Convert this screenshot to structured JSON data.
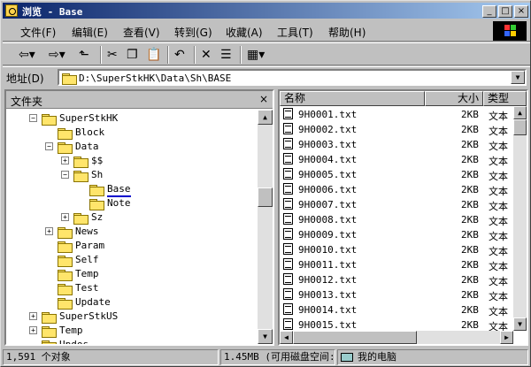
{
  "window": {
    "title": "浏览 - Base"
  },
  "menu": [
    "文件(F)",
    "编辑(E)",
    "查看(V)",
    "转到(G)",
    "收藏(A)",
    "工具(T)",
    "帮助(H)"
  ],
  "address": {
    "label": "地址(D)",
    "value": "D:\\SuperStkHK\\Data\\Sh\\BASE"
  },
  "tree": {
    "title": "文件夹",
    "close": "×",
    "items": [
      {
        "label": "SuperStkHK",
        "exp": "−"
      },
      {
        "label": "Block",
        "exp": ""
      },
      {
        "label": "Data",
        "exp": "−"
      },
      {
        "label": "$$",
        "exp": "+"
      },
      {
        "label": "Sh",
        "exp": "−"
      },
      {
        "label": "Base",
        "exp": ""
      },
      {
        "label": "Note",
        "exp": ""
      },
      {
        "label": "Sz",
        "exp": "+"
      },
      {
        "label": "News",
        "exp": "+"
      },
      {
        "label": "Param",
        "exp": ""
      },
      {
        "label": "Self",
        "exp": ""
      },
      {
        "label": "Temp",
        "exp": ""
      },
      {
        "label": "Test",
        "exp": ""
      },
      {
        "label": "Update",
        "exp": ""
      },
      {
        "label": "SuperStkUS",
        "exp": "+"
      },
      {
        "label": "Temp",
        "exp": "+"
      },
      {
        "label": "Updos",
        "exp": ""
      }
    ]
  },
  "list": {
    "headers": {
      "name": "名称",
      "size": "大小",
      "type": "类型"
    },
    "rows": [
      {
        "name": "9H0001.txt",
        "size": "2KB",
        "type": "文本"
      },
      {
        "name": "9H0002.txt",
        "size": "2KB",
        "type": "文本"
      },
      {
        "name": "9H0003.txt",
        "size": "2KB",
        "type": "文本"
      },
      {
        "name": "9H0004.txt",
        "size": "2KB",
        "type": "文本"
      },
      {
        "name": "9H0005.txt",
        "size": "2KB",
        "type": "文本"
      },
      {
        "name": "9H0006.txt",
        "size": "2KB",
        "type": "文本"
      },
      {
        "name": "9H0007.txt",
        "size": "2KB",
        "type": "文本"
      },
      {
        "name": "9H0008.txt",
        "size": "2KB",
        "type": "文本"
      },
      {
        "name": "9H0009.txt",
        "size": "2KB",
        "type": "文本"
      },
      {
        "name": "9H0010.txt",
        "size": "2KB",
        "type": "文本"
      },
      {
        "name": "9H0011.txt",
        "size": "2KB",
        "type": "文本"
      },
      {
        "name": "9H0012.txt",
        "size": "2KB",
        "type": "文本"
      },
      {
        "name": "9H0013.txt",
        "size": "2KB",
        "type": "文本"
      },
      {
        "name": "9H0014.txt",
        "size": "2KB",
        "type": "文本"
      },
      {
        "name": "9H0015.txt",
        "size": "2KB",
        "type": "文本"
      }
    ]
  },
  "status": {
    "count": "1,591 个对象",
    "space": "1.45MB (可用磁盘空间:",
    "location": "我的电脑"
  }
}
